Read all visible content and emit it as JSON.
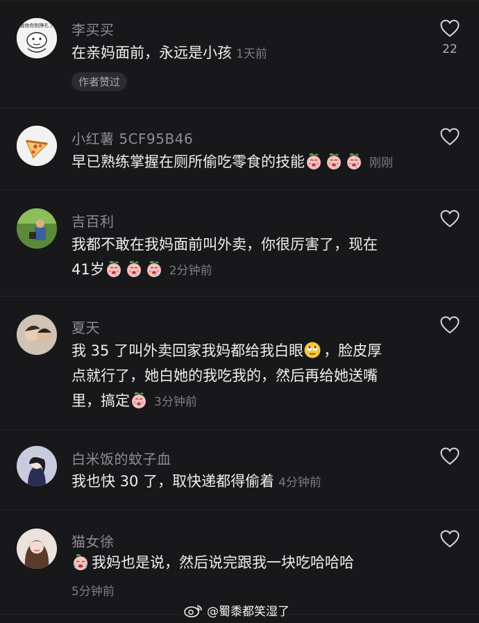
{
  "comments": [
    {
      "username": "李买买",
      "text": "在亲妈面前，永远是小孩",
      "time": "1天前",
      "badge": "作者赞过",
      "likes": "22",
      "avatar_text": "我劝你别挣扎了"
    },
    {
      "username": "小红薯 5CF95B46",
      "text": "早已熟练掌握在厕所偷吃零食的技能",
      "time": "刚刚"
    },
    {
      "username": "吉百利",
      "text_line1": "我都不敢在我妈面前叫外卖，你很厉害了，现在",
      "text_line2": "41岁",
      "time": "2分钟前"
    },
    {
      "username": "夏天",
      "text_line1a": "我 35 了叫外卖回家我妈都给我白眼",
      "text_line1b": "，脸皮厚",
      "text_line2": "点就行了，她白她的我吃我的，然后再给她送嘴",
      "text_line3": "里，搞定",
      "time": "3分钟前"
    },
    {
      "username": "白米饭的蚊子血",
      "text": "我也快 30 了，取快递都得偷着",
      "time": "4分钟前"
    },
    {
      "username": "猫女徐",
      "text": "我妈也是说，然后说完跟我一块吃哈哈哈",
      "time": "5分钟前"
    }
  ],
  "watermark": {
    "text": "@蜀黍都笑湿了"
  },
  "colors": {
    "background": "#18181a",
    "username": "#8d8d92",
    "text": "#efefef",
    "time": "#7c7c82"
  },
  "icons": {
    "like": "heart-outline-icon",
    "emoji_peach": "peach-drooling-emoji",
    "emoji_rolleyes": "eye-roll-emoji",
    "emoji_crying": "crying-peach-emoji",
    "watermark": "weibo-logo-icon"
  }
}
